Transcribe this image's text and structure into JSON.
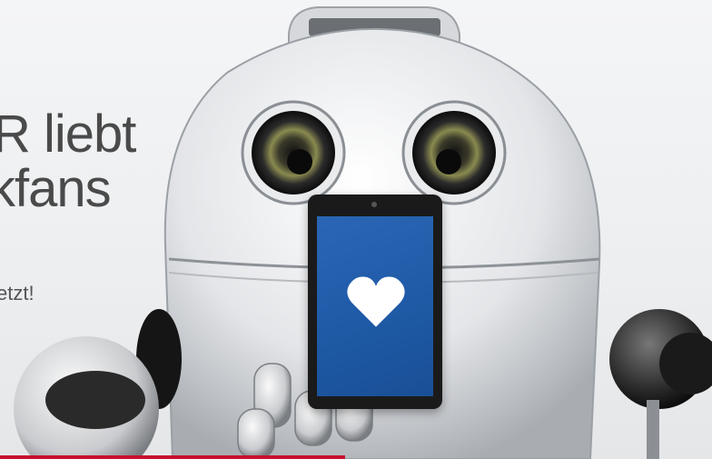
{
  "banner": {
    "headline_line1": "R liebt",
    "headline_line2": "kfans",
    "subline": "etzt!"
  },
  "colors": {
    "screen_blue": "#1e5aa6",
    "accent_red": "#c8102e",
    "text_gray": "#4a4a4a"
  },
  "icons": {
    "heart": "heart-icon",
    "robot": "robot-illustration"
  }
}
